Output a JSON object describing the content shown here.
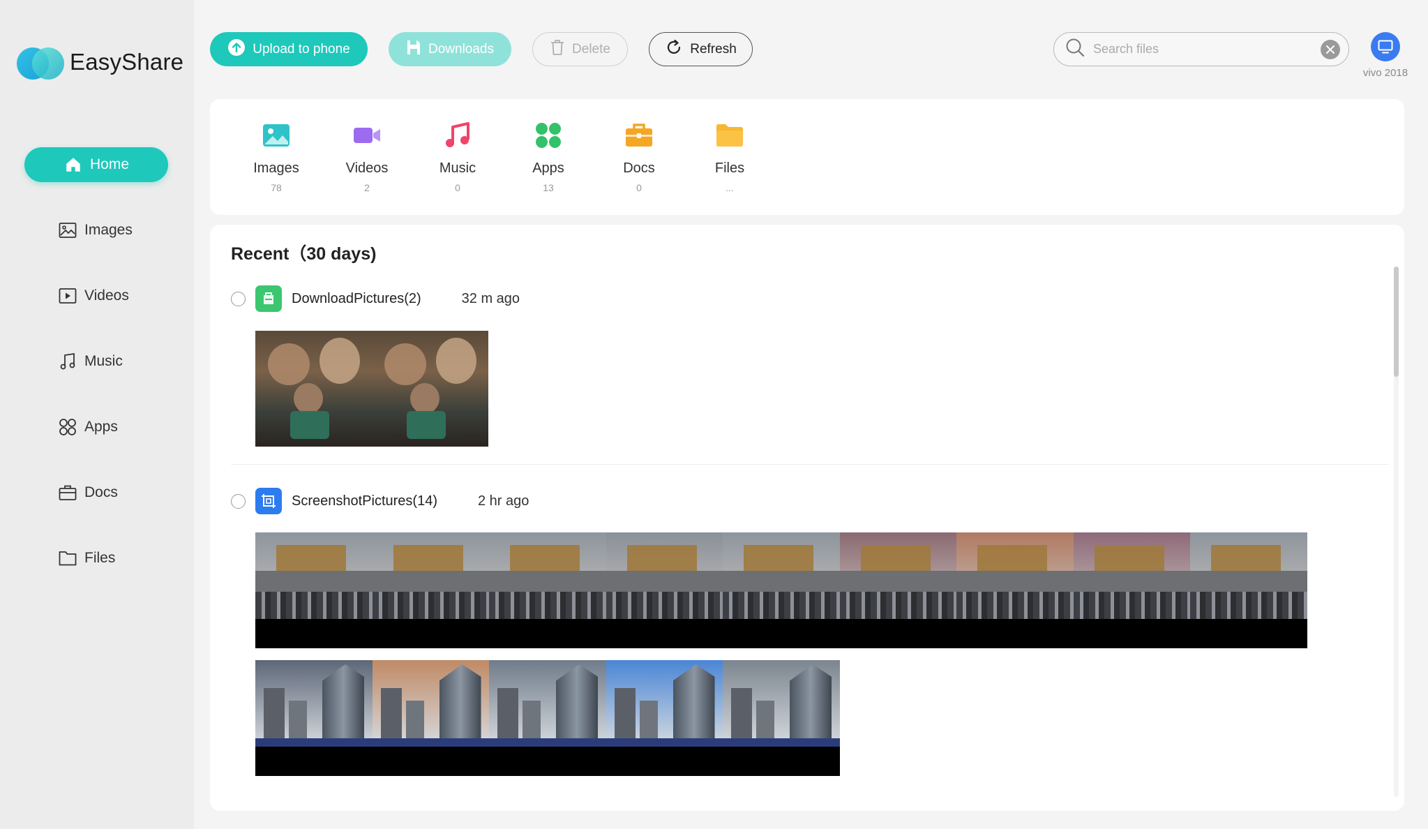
{
  "app": {
    "name": "EasyShare"
  },
  "sidebar": {
    "items": [
      {
        "label": "Home",
        "icon": "home-icon",
        "active": true
      },
      {
        "label": "Images",
        "icon": "image-icon"
      },
      {
        "label": "Videos",
        "icon": "video-icon"
      },
      {
        "label": "Music",
        "icon": "music-icon"
      },
      {
        "label": "Apps",
        "icon": "apps-icon"
      },
      {
        "label": "Docs",
        "icon": "briefcase-icon"
      },
      {
        "label": "Files",
        "icon": "folder-icon"
      }
    ]
  },
  "toolbar": {
    "upload_label": "Upload to phone",
    "downloads_label": "Downloads",
    "delete_label": "Delete",
    "refresh_label": "Refresh"
  },
  "search": {
    "placeholder": "Search files",
    "value": ""
  },
  "device": {
    "name": "vivo 2018",
    "color": "#3a7bf0"
  },
  "categories": [
    {
      "label": "Images",
      "count": "78",
      "color": "#2fc3c9"
    },
    {
      "label": "Videos",
      "count": "2",
      "color": "#9b6cf0"
    },
    {
      "label": "Music",
      "count": "0",
      "color": "#f0446b"
    },
    {
      "label": "Apps",
      "count": "13",
      "color": "#33c26a"
    },
    {
      "label": "Docs",
      "count": "0",
      "color": "#f5a623"
    },
    {
      "label": "Files",
      "count": "...",
      "color": "#f7b731"
    }
  ],
  "recent": {
    "title": "Recent（30 days)",
    "groups": [
      {
        "name": "DownloadPictures(2)",
        "time": "32 m ago",
        "icon": "download-folder-icon",
        "icon_color": "#3cc66f"
      },
      {
        "name": "ScreenshotPictures(14)",
        "time": "2 hr ago",
        "icon": "screenshot-icon",
        "icon_color": "#2d7bf0"
      }
    ]
  },
  "colors": {
    "accent": "#1ec8bb",
    "accent_disabled": "#8fe2da"
  }
}
